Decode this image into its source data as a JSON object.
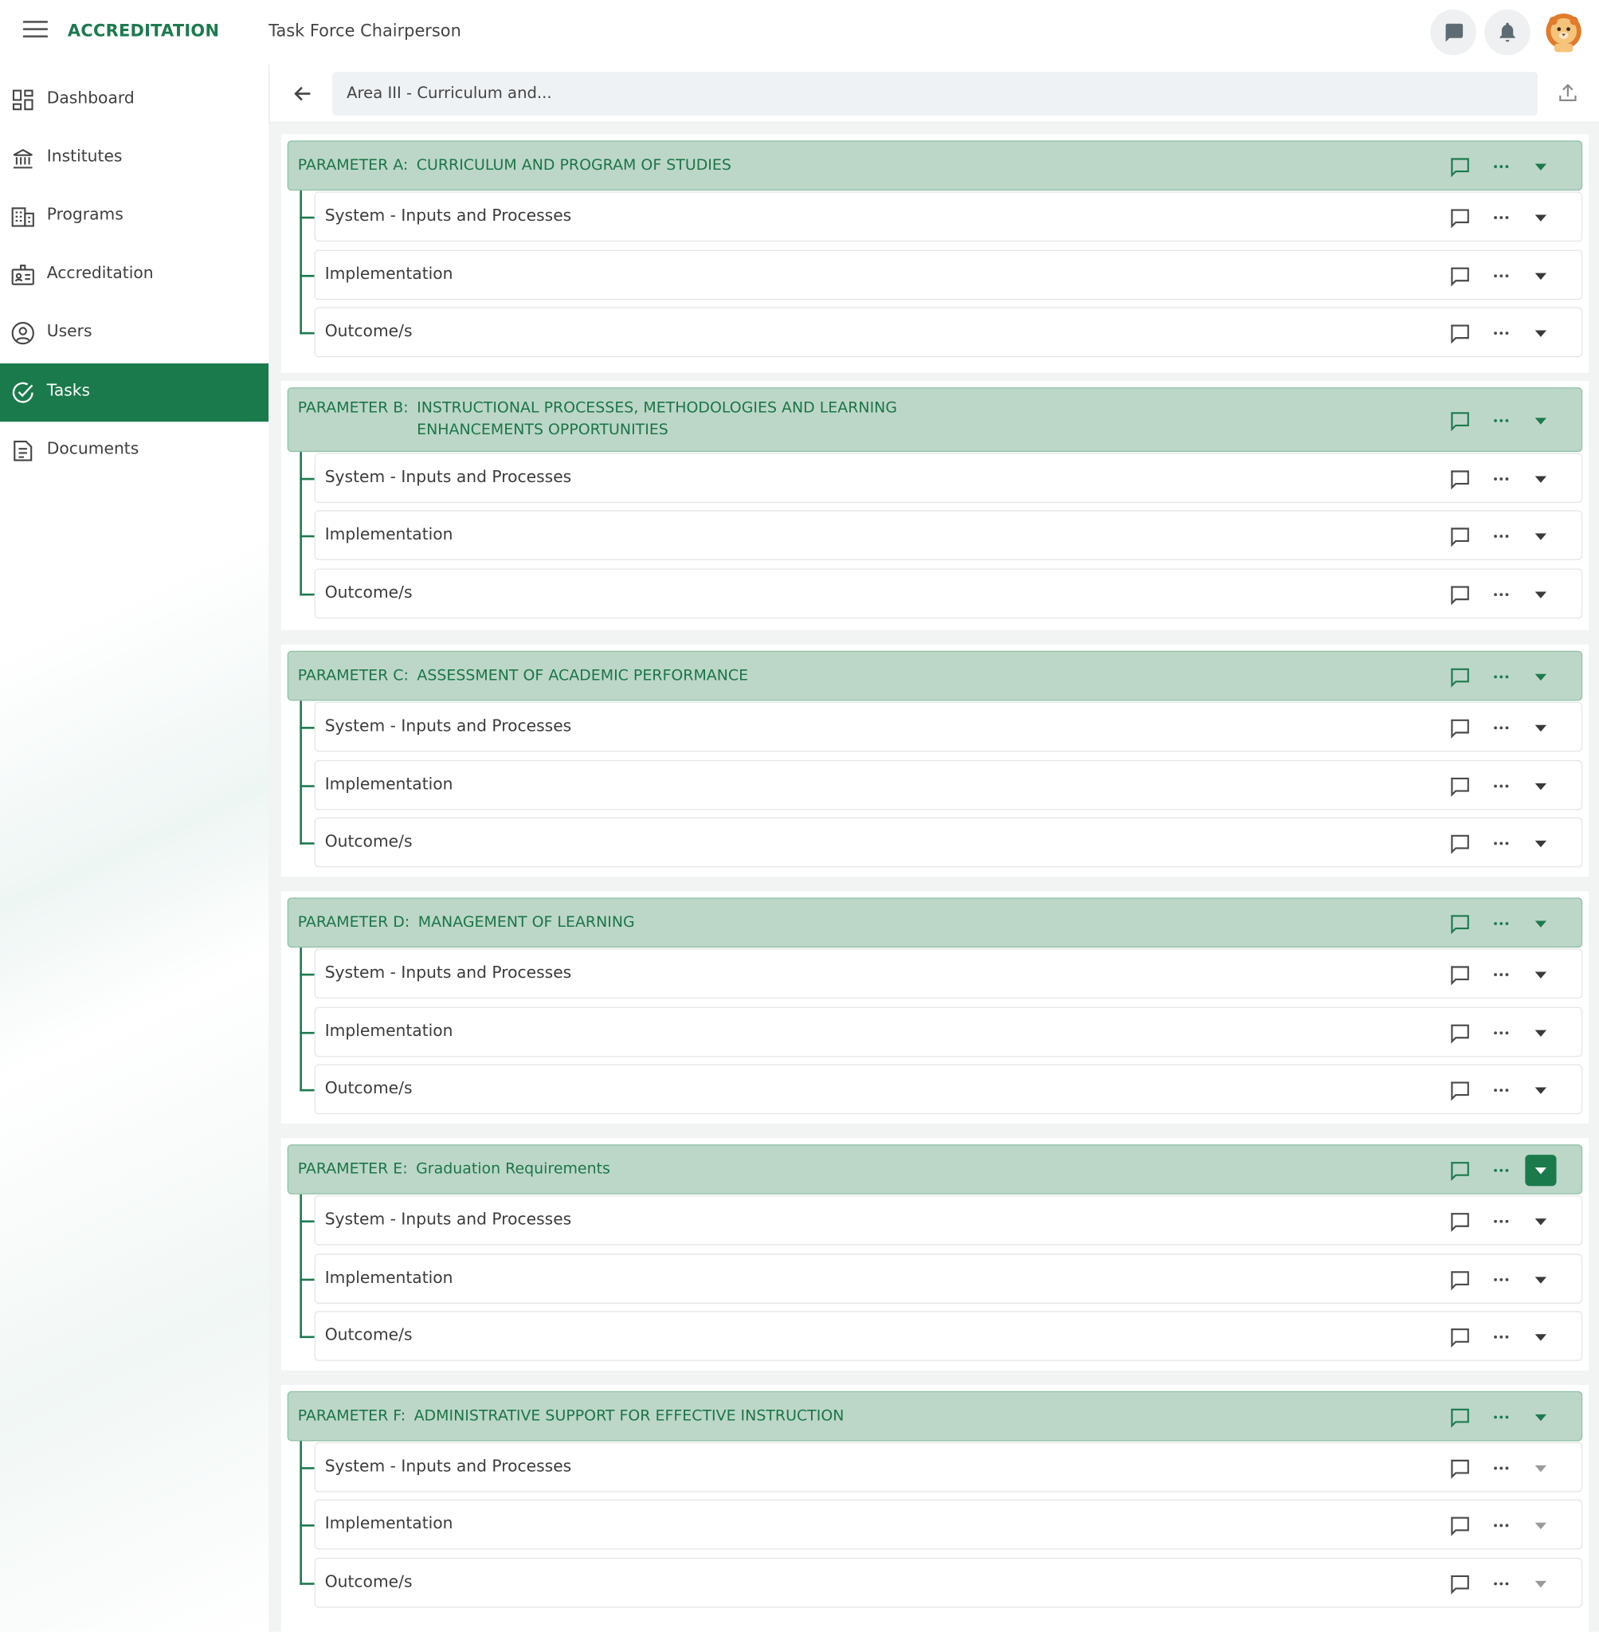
{
  "app": {
    "brand": "ACCREDITATION",
    "role": "Task Force Chairperson"
  },
  "icons": {
    "menu": "hamburger-icon",
    "chat": "chat-bubble-icon",
    "bell": "bell-icon",
    "avatar": "lion-avatar",
    "back": "arrow-left-icon",
    "upload": "upload-icon",
    "comment": "comment-icon",
    "more": "more-horizontal-icon",
    "expand": "caret-down-icon"
  },
  "colors": {
    "brand": "#1b7a4c",
    "param_bg": "#bcd7c8",
    "param_text": "#1c7548",
    "main_bg": "#f1f4f3"
  },
  "sidebar": {
    "items": [
      {
        "label": "Dashboard",
        "icon": "dashboard-icon"
      },
      {
        "label": "Institutes",
        "icon": "institution-icon"
      },
      {
        "label": "Programs",
        "icon": "building-icon"
      },
      {
        "label": "Accreditation",
        "icon": "badge-icon"
      },
      {
        "label": "Users",
        "icon": "user-circle-icon"
      },
      {
        "label": "Tasks",
        "icon": "check-circle-icon",
        "active": true
      },
      {
        "label": "Documents",
        "icon": "document-icon"
      }
    ]
  },
  "header": {
    "breadcrumb": "Area III - Curriculum and..."
  },
  "parameters": [
    {
      "label": "PARAMETER A:",
      "name": "CURRICULUM AND PROGRAM OF STUDIES",
      "items": [
        "System - Inputs and Processes",
        "Implementation",
        "Outcome/s"
      ]
    },
    {
      "label": "PARAMETER B:",
      "name": "INSTRUCTIONAL PROCESSES, METHODOLOGIES AND LEARNING ENHANCEMENTS OPPORTUNITIES",
      "items": [
        "System - Inputs and Processes",
        "Implementation",
        "Outcome/s"
      ]
    },
    {
      "label": "PARAMETER C:",
      "name": "ASSESSMENT OF ACADEMIC PERFORMANCE",
      "items": [
        "System - Inputs and Processes",
        "Implementation",
        "Outcome/s"
      ]
    },
    {
      "label": "PARAMETER D:",
      "name": "MANAGEMENT OF LEARNING",
      "items": [
        "System - Inputs and Processes",
        "Implementation",
        "Outcome/s"
      ]
    },
    {
      "label": "PARAMETER E:",
      "name": "Graduation Requirements",
      "expand_highlighted": true,
      "items": [
        "System - Inputs and Processes",
        "Implementation",
        "Outcome/s"
      ]
    },
    {
      "label": "PARAMETER F:",
      "name": "ADMINISTRATIVE SUPPORT FOR EFFECTIVE INSTRUCTION",
      "items_expand_disabled": true,
      "items": [
        "System - Inputs and Processes",
        "Implementation",
        "Outcome/s"
      ]
    }
  ]
}
